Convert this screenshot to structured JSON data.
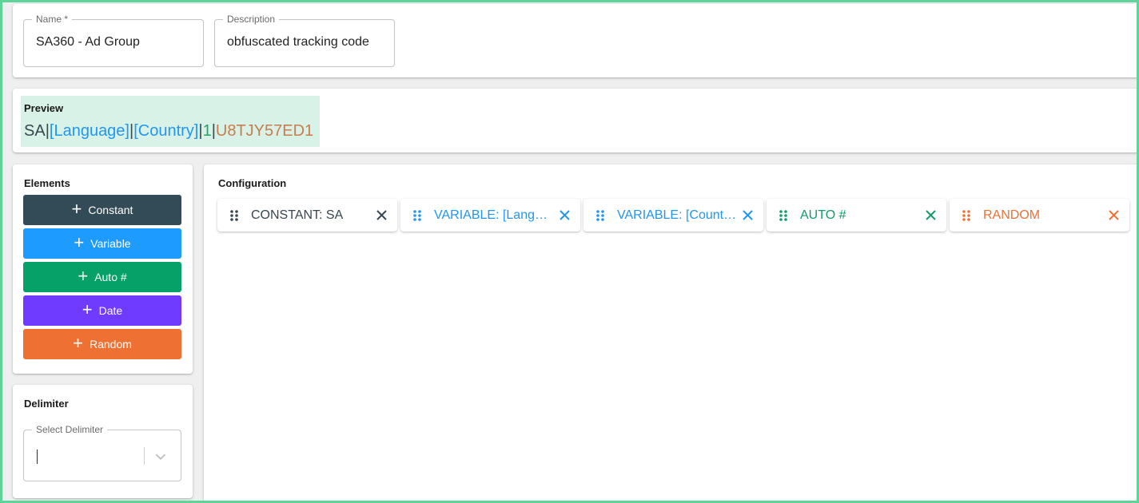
{
  "form": {
    "name_label": "Name *",
    "name_value": "SA360 - Ad Group",
    "description_label": "Description",
    "description_value": "obfuscated tracking code"
  },
  "preview": {
    "title": "Preview",
    "parts": [
      {
        "text": "SA",
        "color": "#37474f"
      },
      {
        "text": "|",
        "color": "#37474f"
      },
      {
        "text": "[Language]",
        "color": "#2196f3"
      },
      {
        "text": "|",
        "color": "#37474f"
      },
      {
        "text": "[Country]",
        "color": "#2196f3"
      },
      {
        "text": "|",
        "color": "#37474f"
      },
      {
        "text": "1",
        "color": "#26a269"
      },
      {
        "text": "|",
        "color": "#37474f"
      },
      {
        "text": "U8TJY57ED1",
        "color": "#c77d4e"
      }
    ]
  },
  "elements": {
    "title": "Elements",
    "buttons": [
      {
        "label": "Constant",
        "color": "#324b56",
        "icon": "plus-icon"
      },
      {
        "label": "Variable",
        "color": "#1e9bff",
        "icon": "plus-icon"
      },
      {
        "label": "Auto #",
        "color": "#05a168",
        "icon": "plus-icon"
      },
      {
        "label": "Date",
        "color": "#6e3bff",
        "icon": "plus-icon"
      },
      {
        "label": "Random",
        "color": "#ef7033",
        "icon": "plus-icon"
      }
    ]
  },
  "delimiter": {
    "title": "Delimiter",
    "select_label": "Select Delimiter",
    "value": ""
  },
  "configuration": {
    "title": "Configuration",
    "chips": [
      {
        "label": "CONSTANT: SA",
        "color": "#37474f",
        "icon": "drag-handle-icon"
      },
      {
        "label": "VARIABLE: [Language]",
        "color": "#2196f3",
        "icon": "drag-handle-icon"
      },
      {
        "label": "VARIABLE: [Country]",
        "color": "#2196f3",
        "icon": "drag-handle-icon"
      },
      {
        "label": "AUTO #",
        "color": "#0f9d68",
        "icon": "drag-handle-icon"
      },
      {
        "label": "RANDOM",
        "color": "#ef7033",
        "icon": "drag-handle-icon"
      }
    ]
  }
}
